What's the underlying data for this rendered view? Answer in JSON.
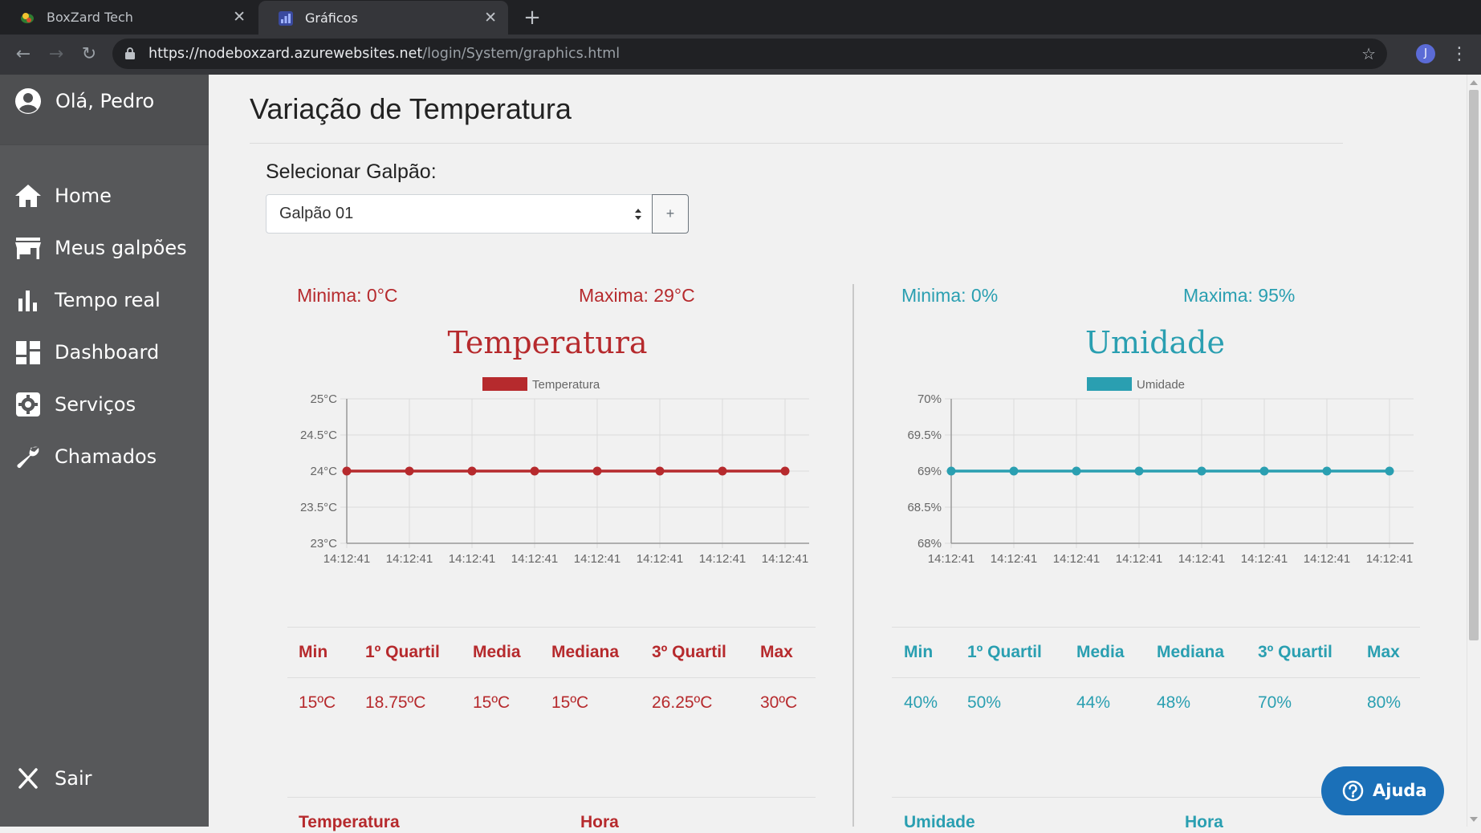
{
  "browser": {
    "tabs": [
      {
        "title": "BoxZard Tech",
        "active": false
      },
      {
        "title": "Gráficos",
        "active": true
      }
    ],
    "new_tab": "+",
    "url_host": "https://nodeboxzard.azurewebsites.net",
    "url_path": "/login/System/graphics.html",
    "profile_initial": "J",
    "close_glyph": "✕",
    "nav": {
      "back": "←",
      "forward": "→",
      "reload": "↻",
      "star": "☆",
      "menu": "⋮"
    }
  },
  "sidebar": {
    "greeting": "Olá, Pedro",
    "items": [
      {
        "label": "Home",
        "icon": "home-icon"
      },
      {
        "label": "Meus galpões",
        "icon": "store-icon"
      },
      {
        "label": "Tempo real",
        "icon": "bar-chart-icon"
      },
      {
        "label": "Dashboard",
        "icon": "dashboard-icon"
      },
      {
        "label": "Serviços",
        "icon": "gear-icon"
      },
      {
        "label": "Chamados",
        "icon": "wrench-icon"
      }
    ],
    "logout": "Sair"
  },
  "main": {
    "title": "Variação de Temperatura",
    "select_label": "Selecionar Galpão:",
    "select_value": "Galpão 01",
    "add_button": "+"
  },
  "temperature": {
    "min_label": "Minima: 0°C",
    "max_label": "Maxima: 29°C",
    "title": "Temperatura",
    "stats_headers": [
      "Min",
      "1º Quartil",
      "Media",
      "Mediana",
      "3º Quartil",
      "Max"
    ],
    "stats_values": [
      "15ºC",
      "18.75ºC",
      "15ºC",
      "15ºC",
      "26.25ºC",
      "30ºC"
    ],
    "list_headers": [
      "Temperatura",
      "Hora"
    ]
  },
  "humidity": {
    "min_label": "Minima: 0%",
    "max_label": "Maxima: 95%",
    "title": "Umidade",
    "stats_headers": [
      "Min",
      "1º Quartil",
      "Media",
      "Mediana",
      "3º Quartil",
      "Max"
    ],
    "stats_values": [
      "40%",
      "50%",
      "44%",
      "48%",
      "70%",
      "80%"
    ],
    "list_headers": [
      "Umidade",
      "Hora"
    ]
  },
  "help_button": "Ajuda",
  "colors": {
    "temperature": "#b62a2d",
    "humidity": "#2a9fb1",
    "sidebar": "#57585a"
  },
  "chart_data": [
    {
      "type": "line",
      "legend": [
        "Temperatura"
      ],
      "categories": [
        "14:12:41",
        "14:12:41",
        "14:12:41",
        "14:12:41",
        "14:12:41",
        "14:12:41",
        "14:12:41",
        "14:12:41"
      ],
      "series": [
        {
          "name": "Temperatura",
          "values": [
            24,
            24,
            24,
            24,
            24,
            24,
            24,
            24
          ]
        }
      ],
      "yticks": [
        "25°C",
        "24.5°C",
        "24°C",
        "23.5°C",
        "23°C"
      ],
      "ylim": [
        23,
        25
      ],
      "color": "#b62a2d",
      "grid": true,
      "legend_position": "top"
    },
    {
      "type": "line",
      "legend": [
        "Umidade"
      ],
      "categories": [
        "14:12:41",
        "14:12:41",
        "14:12:41",
        "14:12:41",
        "14:12:41",
        "14:12:41",
        "14:12:41",
        "14:12:41"
      ],
      "series": [
        {
          "name": "Umidade",
          "values": [
            69,
            69,
            69,
            69,
            69,
            69,
            69,
            69
          ]
        }
      ],
      "yticks": [
        "70%",
        "69.5%",
        "69%",
        "68.5%",
        "68%"
      ],
      "ylim": [
        68,
        70
      ],
      "color": "#2a9fb1",
      "grid": true,
      "legend_position": "top"
    }
  ]
}
